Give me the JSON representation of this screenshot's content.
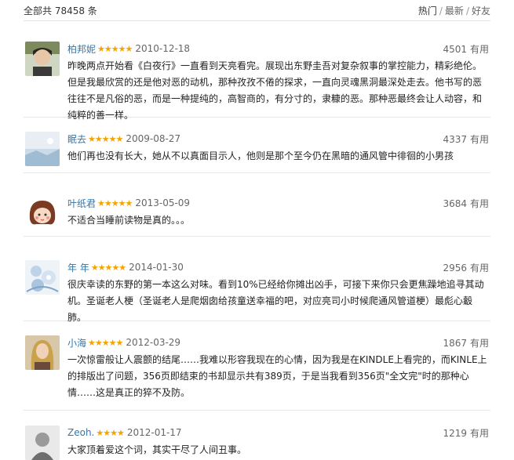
{
  "header": {
    "total": "全部共 78458 条",
    "sort": [
      "热门",
      "最新",
      "好友"
    ]
  },
  "reviews": [
    {
      "user": "柏邦妮",
      "stars": "★★★★★",
      "date": "2010-12-18",
      "votes": "4501",
      "useful": "有用",
      "avatar_icon": "user-photo-icon",
      "content": "昨晚两点开始看《白夜行》一直看到天亮看完。展现出东野圭吾对复杂叙事的掌控能力，精彩绝伦。但是我最欣赏的还是他对恶的动机，那种孜孜不倦的探求，一直向灵魂黑洞最深处走去。他书写的恶往往不是凡俗的恶，而是一种提纯的，高智商的，有分寸的，隶糠的恶。那种恶最终会让人动容，和纯粹的善一样。"
    },
    {
      "user": "眠去",
      "stars": "★★★★★",
      "date": "2009-08-27",
      "votes": "4337",
      "useful": "有用",
      "avatar_icon": "landscape-avatar-icon",
      "content": "他们再也没有长大，她从不以真面目示人，他则是那个至今仍在黑暗的通风管中徘徊的小男孩"
    },
    {
      "user": "叶纸君",
      "stars": "★★★★★",
      "date": "2013-05-09",
      "votes": "3684",
      "useful": "有用",
      "avatar_icon": "cartoon-girl-icon",
      "content": "不适合当睡前读物是真的。。。"
    },
    {
      "user": "年 年",
      "stars": "★★★★★",
      "date": "2014-01-30",
      "votes": "2956",
      "useful": "有用",
      "avatar_icon": "flower-avatar-icon",
      "content": "很庆幸读的东野的第一本这么对味。看到10%已经给你摊出凶手，可接下来你只会更焦躁地追寻其动机。圣诞老人梗（圣诞老人是爬烟囱给孩童送幸福的吧，对应亮司小时候爬通风管道梗）最彪心觳肺。"
    },
    {
      "user": "小海",
      "stars": "★★★★★",
      "date": "2012-03-29",
      "votes": "1867",
      "useful": "有用",
      "avatar_icon": "portrait-avatar-icon",
      "content": "一次惊雷般让人震颤的结尾……我难以形容我现在的心情，因为我是在KINDLE上看完的，而KINLE上的排版出了问题，356页即结束的书却显示共有389页，于是当我看到356页\"全文完\"时的那种心情……这是真正的猝不及防。"
    },
    {
      "user": "Zeoh.",
      "stars": "★★★★",
      "date": "2012-01-17",
      "votes": "1219",
      "useful": "有用",
      "avatar_icon": "mono-avatar-icon",
      "content": "大家顶着爱这个词，其实干尽了人间丑事。"
    }
  ]
}
